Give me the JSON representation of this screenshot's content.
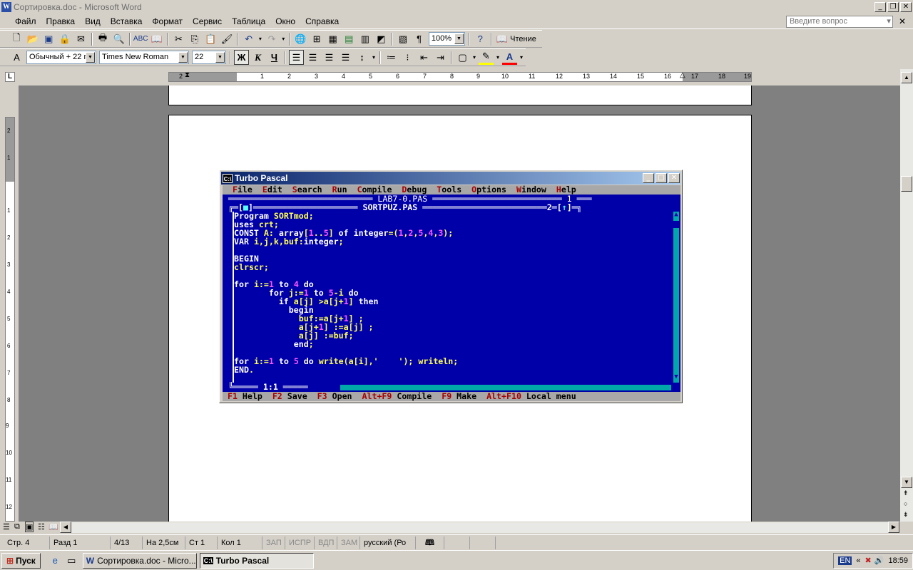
{
  "window": {
    "title": "Сортировка.doc - Microsoft Word",
    "icon_letter": "W"
  },
  "menu": [
    "Файл",
    "Правка",
    "Вид",
    "Вставка",
    "Формат",
    "Сервис",
    "Таблица",
    "Окно",
    "Справка"
  ],
  "ask_placeholder": "Введите вопрос",
  "toolbar1": {
    "zoom": "100%",
    "read_label": "Чтение"
  },
  "toolbar2": {
    "style": "Обычный + 22 г",
    "font": "Times New Roman",
    "size": "22",
    "bold": "Ж",
    "italic": "К",
    "underline": "Ч"
  },
  "ruler": {
    "numbers": [
      "2",
      "1",
      "1",
      "2",
      "3",
      "4",
      "5",
      "6",
      "7",
      "8",
      "9",
      "10",
      "11",
      "12",
      "13",
      "14",
      "15",
      "16",
      "17",
      "18",
      "19"
    ]
  },
  "vruler": {
    "numbers": [
      "2",
      "1",
      "1",
      "2",
      "3",
      "4",
      "5",
      "6",
      "7",
      "8",
      "9",
      "10",
      "11",
      "12"
    ]
  },
  "turbo": {
    "title": "Turbo Pascal",
    "menu": [
      {
        "hk": "F",
        "rest": "ile"
      },
      {
        "hk": "E",
        "rest": "dit"
      },
      {
        "hk": "S",
        "rest": "earch"
      },
      {
        "hk": "R",
        "rest": "un"
      },
      {
        "hk": "C",
        "rest": "ompile"
      },
      {
        "hk": "D",
        "rest": "ebug"
      },
      {
        "hk": "T",
        "rest": "ools"
      },
      {
        "hk": "O",
        "rest": "ptions"
      },
      {
        "hk": "W",
        "rest": "indow"
      },
      {
        "hk": "H",
        "rest": "elp"
      }
    ],
    "back_window": {
      "name": "LAB7-0.PAS",
      "number": "1"
    },
    "front_window": {
      "name": "SORTPUZ.PAS",
      "number": "2"
    },
    "cursor_pos": "1:1",
    "code": [
      "Program SORTmod;",
      "uses crt;",
      "CONST A: array[1..5] of integer=(1,2,5,4,3);",
      "VAR i,j,k,buf:integer;",
      "",
      "BEGIN",
      "clrscr;",
      "",
      "for i:=1 to 4 do",
      "       for j:=1 to 5-i do",
      "         if a[j] >a[j+1] then",
      "           begin",
      "             buf:=a[j+1] ;",
      "             a[j+1] :=a[j] ;",
      "             a[j] :=buf;",
      "            end;",
      "",
      "for i:=1 to 5 do write(a[i],'    '); writeln;",
      "END."
    ],
    "status": [
      {
        "hk": "F1",
        "text": "Help"
      },
      {
        "hk": "F2",
        "text": "Save"
      },
      {
        "hk": "F3",
        "text": "Open"
      },
      {
        "hk": "Alt+F9",
        "text": "Compile"
      },
      {
        "hk": "F9",
        "text": "Make"
      },
      {
        "hk": "Alt+F10",
        "text": "Local menu"
      }
    ]
  },
  "statusbar": {
    "page": "Стр. 4",
    "section": "Разд 1",
    "pages": "4/13",
    "at": "На 2,5см",
    "line": "Ст 1",
    "col": "Кол 1",
    "rec": "ЗАП",
    "trk": "ИСПР",
    "ext": "ВДП",
    "ovr": "ЗАМ",
    "lang": "русский (Ро"
  },
  "taskbar": {
    "start": "Пуск",
    "tasks": [
      "Сортировка.doc - Micro...",
      "Turbo Pascal"
    ],
    "lang": "EN",
    "clock": "18:59"
  }
}
